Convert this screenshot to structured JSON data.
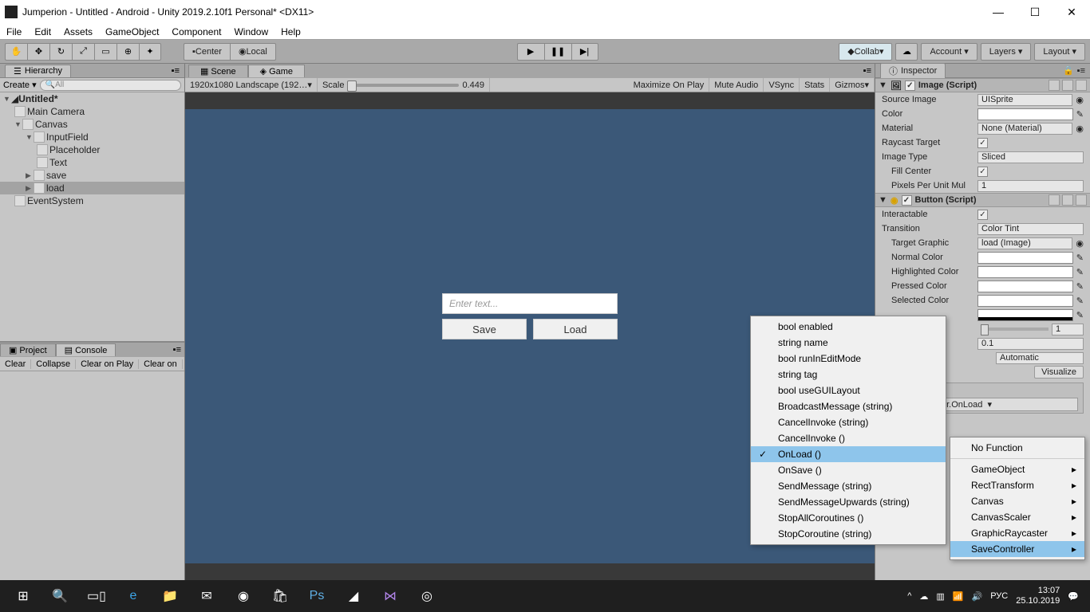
{
  "window": {
    "title": "Jumperion - Untitled - Android - Unity 2019.2.10f1 Personal* <DX11>"
  },
  "menu": [
    "File",
    "Edit",
    "Assets",
    "GameObject",
    "Component",
    "Window",
    "Help"
  ],
  "toolbar": {
    "center": "Center",
    "local": "Local",
    "collab": "Collab",
    "account": "Account",
    "layers": "Layers",
    "layout": "Layout"
  },
  "hierarchy": {
    "tab": "Hierarchy",
    "create": "Create",
    "search_placeholder": "All",
    "scene": "Untitled*",
    "nodes": {
      "main_camera": "Main Camera",
      "canvas": "Canvas",
      "input_field": "InputField",
      "placeholder": "Placeholder",
      "text": "Text",
      "save": "save",
      "load": "load",
      "event_system": "EventSystem"
    }
  },
  "project_console": {
    "project": "Project",
    "console": "Console",
    "sub": [
      "Clear",
      "Collapse",
      "Clear on Play",
      "Clear on"
    ]
  },
  "center_tabs": {
    "scene": "Scene",
    "game": "Game"
  },
  "game_toolbar": {
    "resolution": "1920x1080 Landscape (192…",
    "scale": "Scale",
    "scale_val": "0.449",
    "opts": [
      "Maximize On Play",
      "Mute Audio",
      "VSync",
      "Stats",
      "Gizmos"
    ]
  },
  "game_ui": {
    "placeholder": "Enter text...",
    "save": "Save",
    "load": "Load"
  },
  "inspector": {
    "tab": "Inspector",
    "image": {
      "title": "Image (Script)",
      "source": "Source Image",
      "source_val": "UISprite",
      "color": "Color",
      "material": "Material",
      "material_val": "None (Material)",
      "raycast": "Raycast Target",
      "imgtype": "Image Type",
      "imgtype_val": "Sliced",
      "fill": "Fill Center",
      "ppu": "Pixels Per Unit Mul",
      "ppu_val": "1"
    },
    "button": {
      "title": "Button (Script)",
      "interactable": "Interactable",
      "transition": "Transition",
      "transition_val": "Color Tint",
      "target": "Target Graphic",
      "target_val": "load (Image)",
      "normal": "Normal Color",
      "highlighted": "Highlighted Color",
      "pressed": "Pressed Color",
      "selected": "Selected Color",
      "mult_val": "1",
      "dur_val": "0.1",
      "nav": "Automatic",
      "visualize": "Visualize"
    },
    "onclick": {
      "dd": "SaveController.OnLoad"
    }
  },
  "popup1": [
    "bool enabled",
    "string name",
    "bool runInEditMode",
    "string tag",
    "bool useGUILayout",
    "BroadcastMessage (string)",
    "CancelInvoke (string)",
    "CancelInvoke ()",
    "OnLoad ()",
    "OnSave ()",
    "SendMessage (string)",
    "SendMessageUpwards (string)",
    "StopAllCoroutines ()",
    "StopCoroutine (string)"
  ],
  "popup2": {
    "no_function": "No Function",
    "items": [
      "GameObject",
      "RectTransform",
      "Canvas",
      "CanvasScaler",
      "GraphicRaycaster",
      "SaveController"
    ]
  },
  "taskbar": {
    "time": "13:07",
    "date": "25.10.2019",
    "lang": "РУС"
  }
}
